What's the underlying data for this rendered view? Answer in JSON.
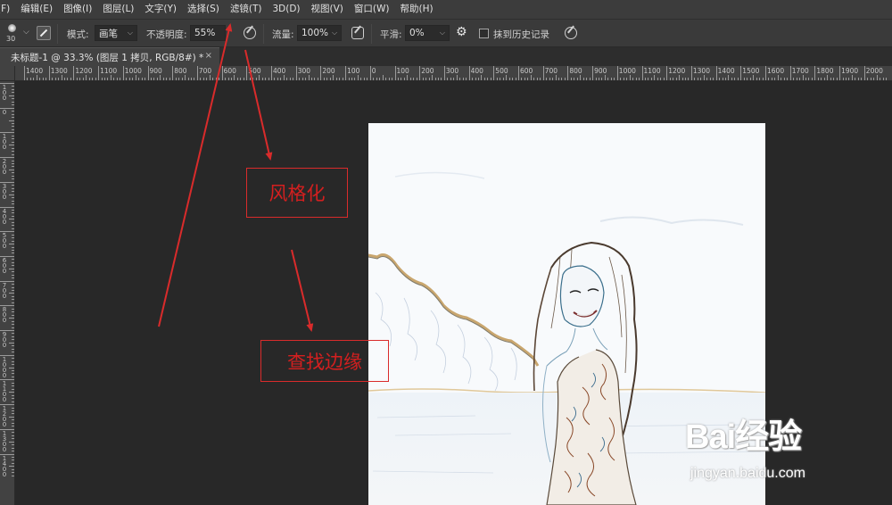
{
  "menu": [
    "(F)",
    "编辑(E)",
    "图像(I)",
    "图层(L)",
    "文字(Y)",
    "选择(S)",
    "滤镜(T)",
    "3D(D)",
    "视图(V)",
    "窗口(W)",
    "帮助(H)"
  ],
  "options": {
    "brush_size": "30",
    "mode_label": "模式:",
    "mode_value": "画笔",
    "opacity_label": "不透明度:",
    "opacity_value": "55%",
    "flow_label": "流量:",
    "flow_value": "100%",
    "smooth_label": "平滑:",
    "smooth_value": "0%",
    "erase_history_label": "抹到历史记录"
  },
  "document": {
    "tab_title": "未标题-1 @ 33.3% (图层 1 拷贝, RGB/8#) *",
    "close_glyph": "×"
  },
  "ruler": {
    "h_labels": [
      "1400",
      "1300",
      "1200",
      "1100",
      "1000",
      "900",
      "800",
      "700",
      "600",
      "500",
      "400",
      "300",
      "200",
      "100",
      "0",
      "100",
      "200",
      "300",
      "400",
      "500",
      "600",
      "700",
      "800",
      "900",
      "1000",
      "1100",
      "1200",
      "1300",
      "1400",
      "1500",
      "1600",
      "1700",
      "1800",
      "1900",
      "2000"
    ],
    "v_labels": [
      "100",
      "0",
      "100",
      "200",
      "300",
      "400",
      "500",
      "600",
      "700",
      "800",
      "900",
      "1000",
      "1100",
      "1200",
      "1300",
      "1400"
    ]
  },
  "annotations": {
    "stylize": "风格化",
    "find_edges": "查找边缘",
    "color": "#d92b2b"
  },
  "watermark": {
    "main": "Bai经验",
    "sub": "jingyan.baidu.com"
  },
  "colors": {
    "menubar": "#3c3c3c",
    "optionbar": "#3a3a3a",
    "workspace": "#282828",
    "annotation_red": "#d92b2b"
  }
}
